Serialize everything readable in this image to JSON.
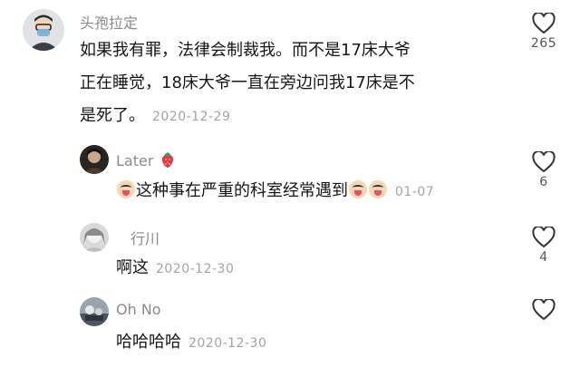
{
  "comments": [
    {
      "user": "头孢拉定",
      "lines": [
        "如果我有罪，法律会制裁我。而不是17床大爷",
        "正在睡觉，18床大爷一直在旁边问我17床是不",
        "是死了。"
      ],
      "date": "2020-12-29",
      "likes": "265"
    },
    {
      "user": "Later",
      "text": "这种事在严重的科室经常遇到",
      "date": "01-07",
      "likes": "6",
      "user_icon": "strawberry-icon",
      "emoji_icon": "crying-emoji-icon"
    },
    {
      "user": "行川",
      "text": "啊这",
      "date": "2020-12-30",
      "likes": "4"
    },
    {
      "user": "Oh No",
      "text": "哈哈哈哈",
      "date": "2020-12-30",
      "likes": ""
    }
  ],
  "colors": {
    "username": "#8a8a8a",
    "date": "#a3a3a3",
    "heart_outline": "#333333"
  }
}
